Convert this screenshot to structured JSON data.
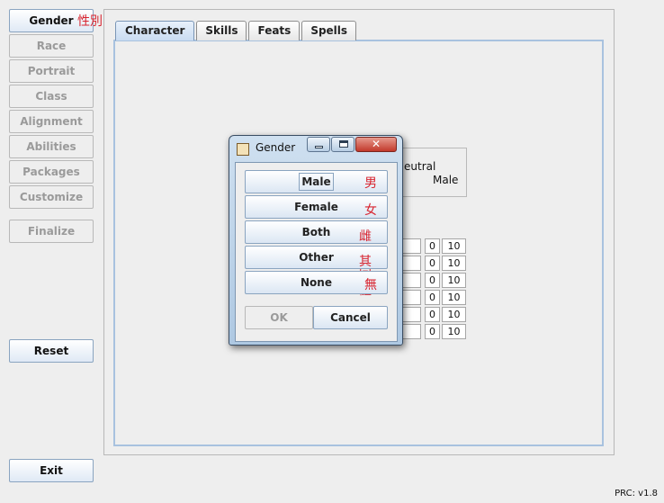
{
  "left_panel": {
    "buttons": [
      {
        "label": "Gender",
        "enabled": true
      },
      {
        "label": "Race",
        "enabled": false
      },
      {
        "label": "Portrait",
        "enabled": false
      },
      {
        "label": "Class",
        "enabled": false
      },
      {
        "label": "Alignment",
        "enabled": false
      },
      {
        "label": "Abilities",
        "enabled": false
      },
      {
        "label": "Packages",
        "enabled": false
      },
      {
        "label": "Customize",
        "enabled": false
      }
    ],
    "gender_annotation": "性別",
    "finalize_label": "Finalize",
    "reset_label": "Reset",
    "exit_label": "Exit"
  },
  "tabs": [
    "Character",
    "Skills",
    "Feats",
    "Spells"
  ],
  "active_tab": "Character",
  "background": {
    "alignment_text": "eutral",
    "gender_text": "Male",
    "stat_values": [
      "0",
      "10"
    ]
  },
  "dialog": {
    "title": "Gender",
    "close_glyph": "✕",
    "choices": [
      {
        "label": "Male",
        "chinese": "男"
      },
      {
        "label": "Female",
        "chinese": "女"
      },
      {
        "label": "Both",
        "chinese": "雌雄同體"
      },
      {
        "label": "Other",
        "chinese": "其他"
      },
      {
        "label": "None",
        "chinese": "無"
      }
    ],
    "ok_label": "OK",
    "cancel_label": "Cancel"
  },
  "version": "PRC: v1.8",
  "colors": {
    "accent": "#a8c2df",
    "annotation_red": "#d8242f",
    "close_red": "#c2392b"
  }
}
